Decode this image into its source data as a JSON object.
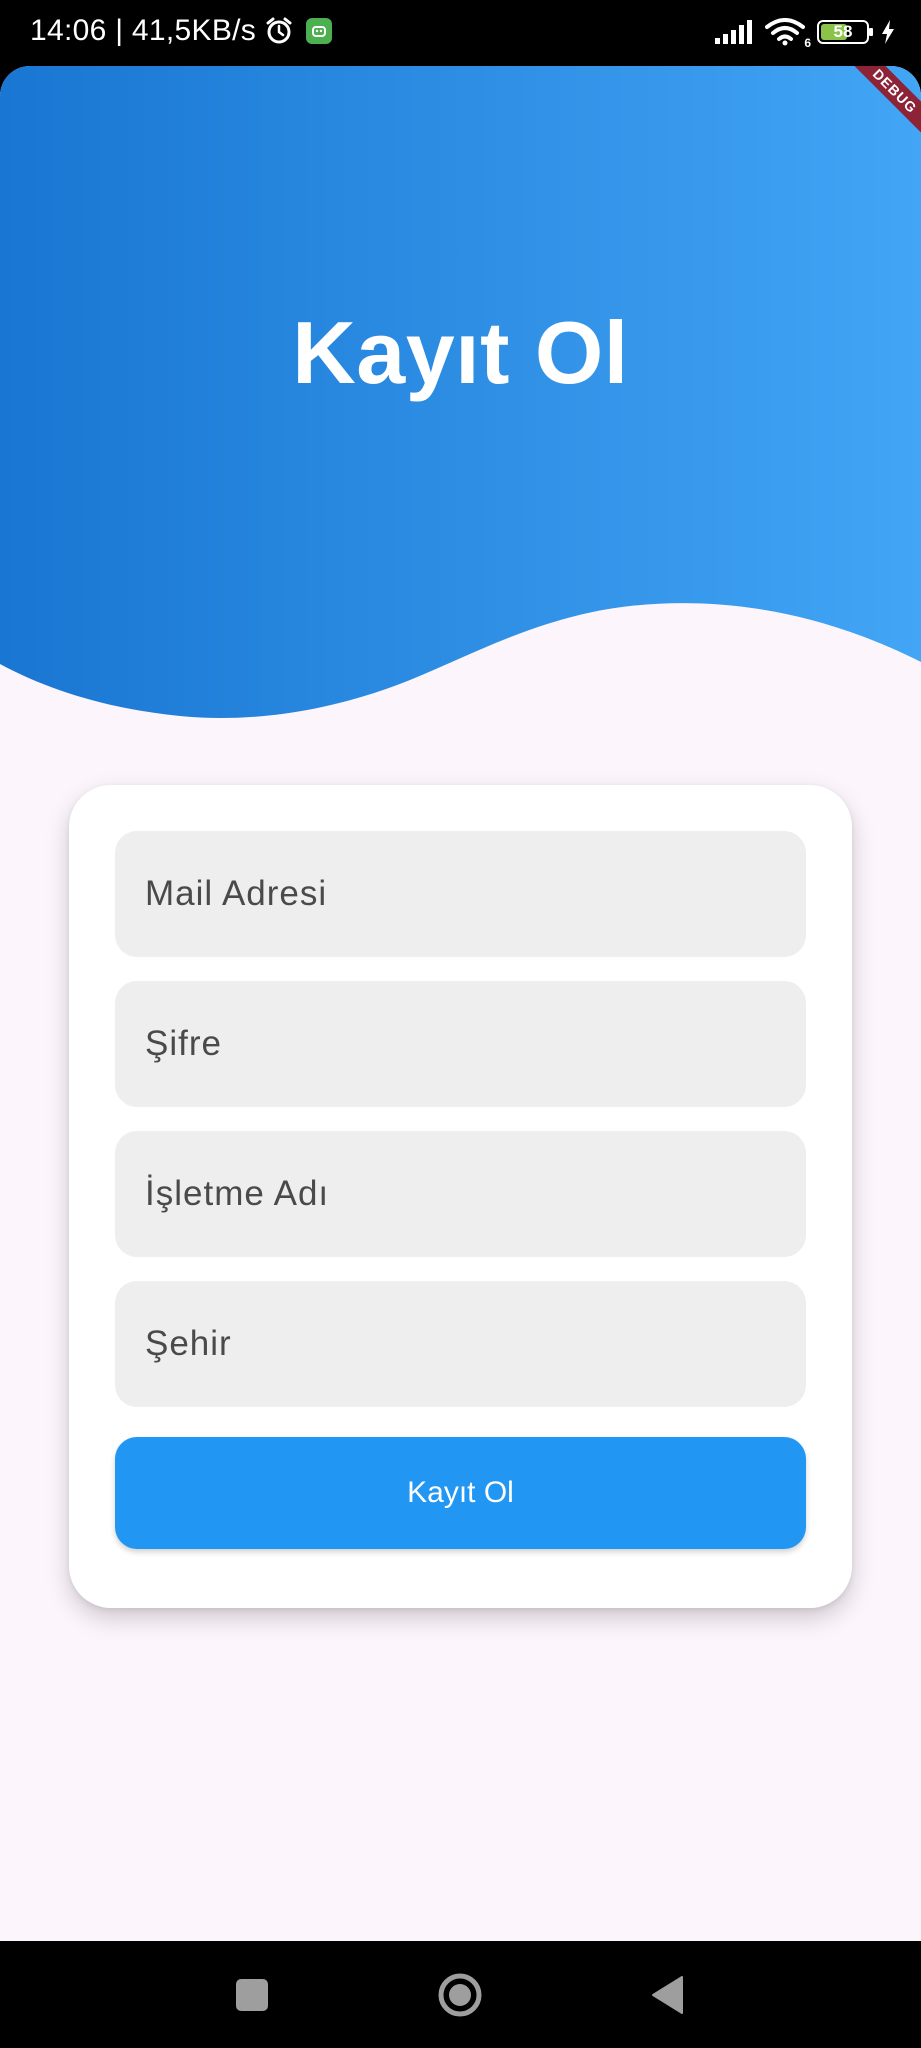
{
  "status_bar": {
    "time_speed": "14:06 | 41,5KB/s",
    "network_type": "6",
    "battery_level": "58"
  },
  "header": {
    "title": "Kayıt Ol",
    "gradient_start": "#1976d2",
    "gradient_end": "#42a5f5",
    "debug_banner": "DEBUG"
  },
  "form": {
    "fields": [
      {
        "placeholder": "Mail Adresi"
      },
      {
        "placeholder": "Şifre"
      },
      {
        "placeholder": "İşletme Adı"
      },
      {
        "placeholder": "Şehir"
      }
    ],
    "submit_label": "Kayıt Ol",
    "accent_color": "#2196f3"
  },
  "nav_bar": {
    "icons": [
      "recents-icon",
      "home-icon",
      "back-icon"
    ]
  }
}
